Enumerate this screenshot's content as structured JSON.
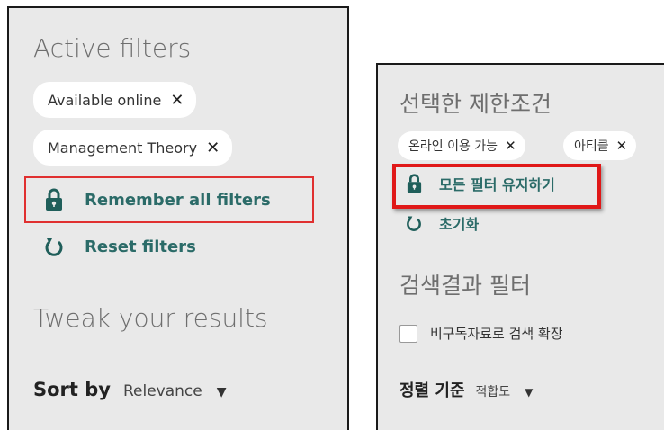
{
  "en": {
    "active_filters_heading": "Active filters",
    "chips": [
      {
        "label": "Available online",
        "remove": "✕"
      },
      {
        "label": "Management Theory",
        "remove": "✕"
      }
    ],
    "remember_label": "Remember all filters",
    "reset_label": "Reset filters",
    "tweak_heading": "Tweak your results",
    "sort_label": "Sort by",
    "sort_value": "Relevance",
    "sort_caret": "▼"
  },
  "ko": {
    "active_filters_heading": "선택한 제한조건",
    "chips": [
      {
        "label": "온라인 이용 가능",
        "remove": "✕"
      },
      {
        "label": "아티클",
        "remove": "✕"
      }
    ],
    "remember_label": "모든 필터 유지하기",
    "reset_label": "초기화",
    "results_filter_heading": "검색결과 필터",
    "expand_label": "비구독자료로 검색 확장",
    "sort_label": "정렬 기준",
    "sort_value": "적합도",
    "sort_caret": "▼"
  },
  "colors": {
    "accent": "#2b6b68",
    "highlight": "#e03030",
    "panel_bg": "#e9e9e9"
  },
  "icons": {
    "lock": "lock-icon",
    "reset": "reset-icon",
    "remove": "close-icon",
    "dropdown": "chevron-down-icon"
  }
}
